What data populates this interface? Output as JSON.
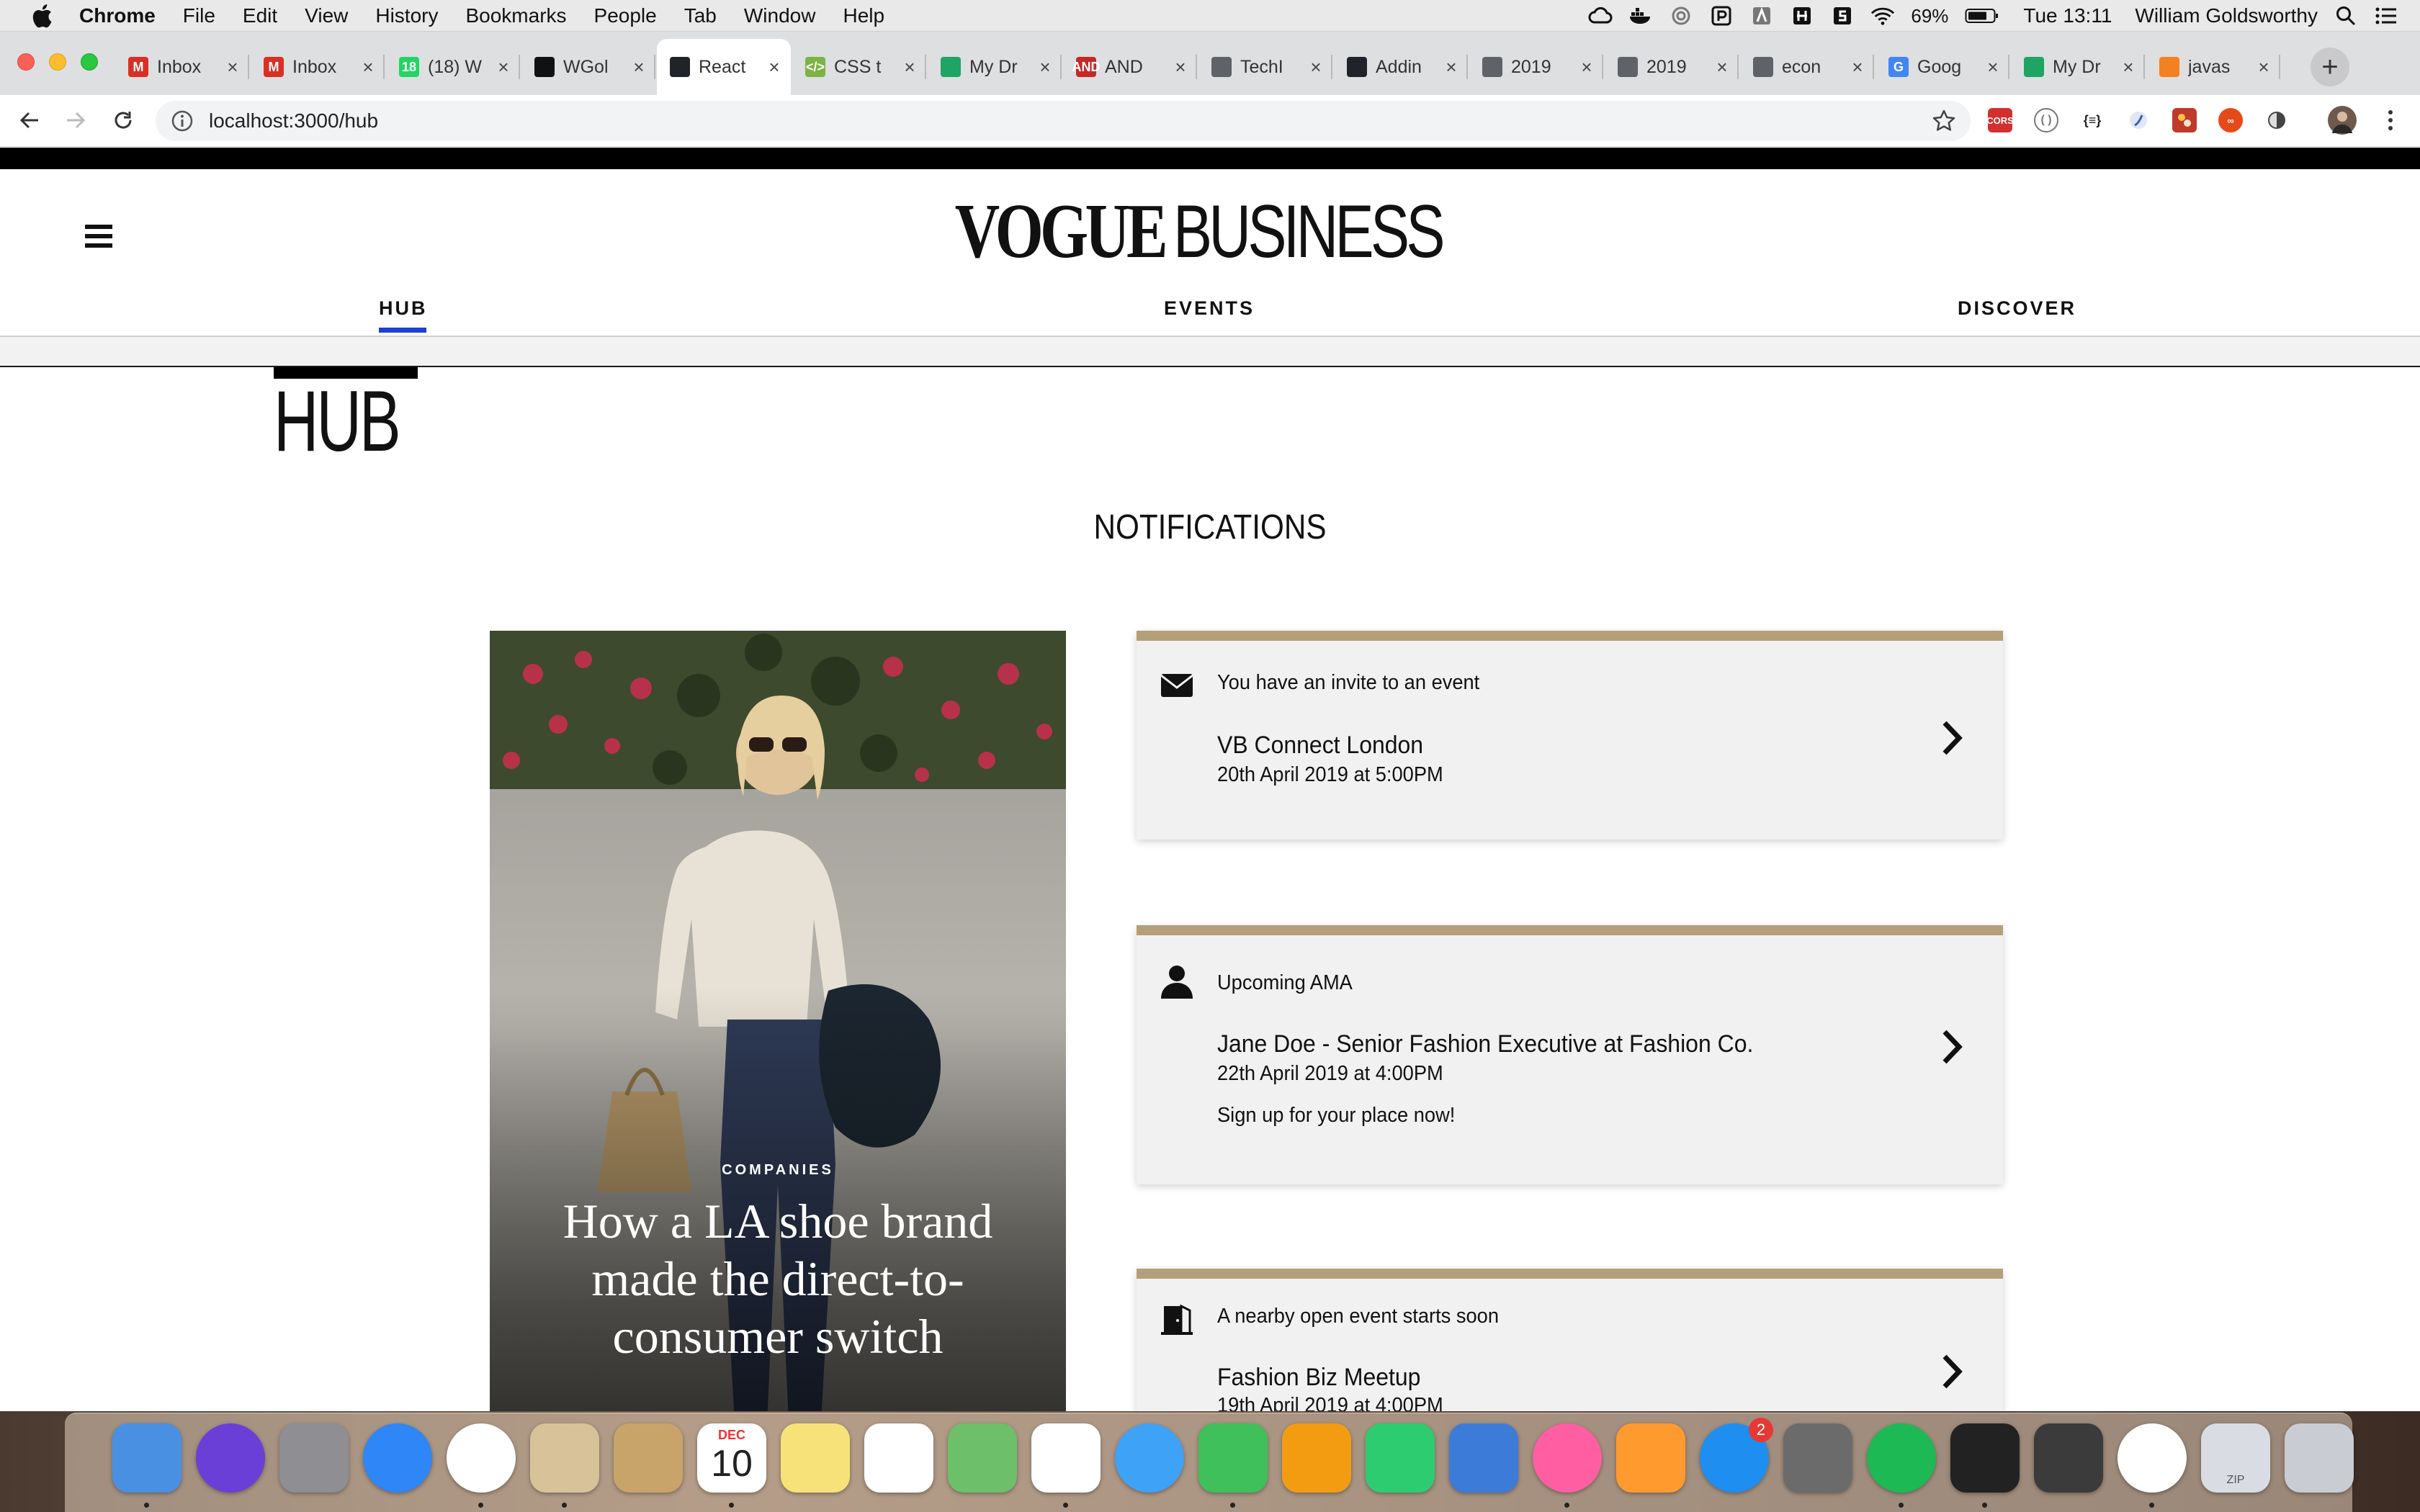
{
  "menubar": {
    "app_name": "Chrome",
    "menus": [
      "File",
      "Edit",
      "View",
      "History",
      "Bookmarks",
      "People",
      "Tab",
      "Window",
      "Help"
    ],
    "battery": "69%",
    "clock": "Tue 13:11",
    "user": "William Goldsworthy"
  },
  "tabs": [
    {
      "title": "Inbox",
      "icon": "gmail-icon",
      "color": "#d93025",
      "glyph": "M"
    },
    {
      "title": "Inbox",
      "icon": "gmail-icon",
      "color": "#d93025",
      "glyph": "M"
    },
    {
      "title": "(18) W",
      "icon": "whatsapp-icon",
      "color": "#25d366",
      "glyph": "18"
    },
    {
      "title": "WGol",
      "icon": "github-icon",
      "color": "#111111",
      "glyph": ""
    },
    {
      "title": "React",
      "icon": "react-icon",
      "color": "#20232a",
      "glyph": "",
      "active": true
    },
    {
      "title": "CSS t",
      "icon": "css-icon",
      "color": "#7cb342",
      "glyph": "</>"
    },
    {
      "title": "My Dr",
      "icon": "google-drive-icon",
      "color": "#1fa463",
      "glyph": ""
    },
    {
      "title": "AND",
      "icon": "and-digital-icon",
      "color": "#c62828",
      "glyph": "AND"
    },
    {
      "title": "TechI",
      "icon": "globe-icon",
      "color": "#5f6368",
      "glyph": ""
    },
    {
      "title": "Addin",
      "icon": "react-icon",
      "color": "#20232a",
      "glyph": ""
    },
    {
      "title": "2019",
      "icon": "globe-icon",
      "color": "#5f6368",
      "glyph": ""
    },
    {
      "title": "2019",
      "icon": "globe-icon",
      "color": "#5f6368",
      "glyph": ""
    },
    {
      "title": "econ",
      "icon": "globe-icon",
      "color": "#5f6368",
      "glyph": ""
    },
    {
      "title": "Goog",
      "icon": "google-icon",
      "color": "#4285f4",
      "glyph": "G"
    },
    {
      "title": "My Dr",
      "icon": "google-drive-icon",
      "color": "#1fa463",
      "glyph": ""
    },
    {
      "title": "javas",
      "icon": "stackoverflow-icon",
      "color": "#f48024",
      "glyph": ""
    }
  ],
  "toolbar": {
    "url": "localhost:3000/hub"
  },
  "site": {
    "logo_vogue": "VOGUE",
    "logo_business": "BUSINESS",
    "nav": [
      {
        "label": "HUB",
        "active": true
      },
      {
        "label": "EVENTS"
      },
      {
        "label": "DISCOVER"
      }
    ],
    "accent_color": "#1f3fd6",
    "card_border_color": "#b39f7a"
  },
  "hub": {
    "title": "HUB",
    "notifications_heading": "NOTIFICATIONS",
    "article": {
      "kicker": "COMPANIES",
      "headline": "How a LA shoe brand made the direct-to-consumer switch"
    },
    "notifications": [
      {
        "icon": "envelope-icon",
        "type": "You have an invite to an event",
        "name": "VB Connect London",
        "date": "20th April 2019 at 5:00PM",
        "extra": ""
      },
      {
        "icon": "person-icon",
        "type": "Upcoming AMA",
        "name": "Jane Doe - Senior Fashion Executive at Fashion Co.",
        "date": "22th April 2019 at 4:00PM",
        "extra": "Sign up for your place now!"
      },
      {
        "icon": "open-door-icon",
        "type": "A nearby open event starts soon",
        "name": "Fashion Biz Meetup",
        "date": "19th April 2019 at 4:00PM",
        "extra": ""
      }
    ]
  },
  "dock": {
    "apps": [
      "Finder",
      "Siri",
      "Launchpad",
      "Safari",
      "Chrome",
      "Mail",
      "Contacts",
      "Calendar",
      "Notes",
      "Reminders",
      "Maps",
      "Photos",
      "Messages",
      "FaceTime",
      "Pages",
      "Numbers",
      "Keynote",
      "iTunes",
      "Books",
      "App Store",
      "System Preferences",
      "Spotify",
      "Terminal",
      "Sublime Text",
      "Slack",
      "Archive",
      "Trash"
    ],
    "calendar_month": "DEC",
    "calendar_day": "10",
    "app_store_badge": "2",
    "archive_label": "ZIP"
  }
}
